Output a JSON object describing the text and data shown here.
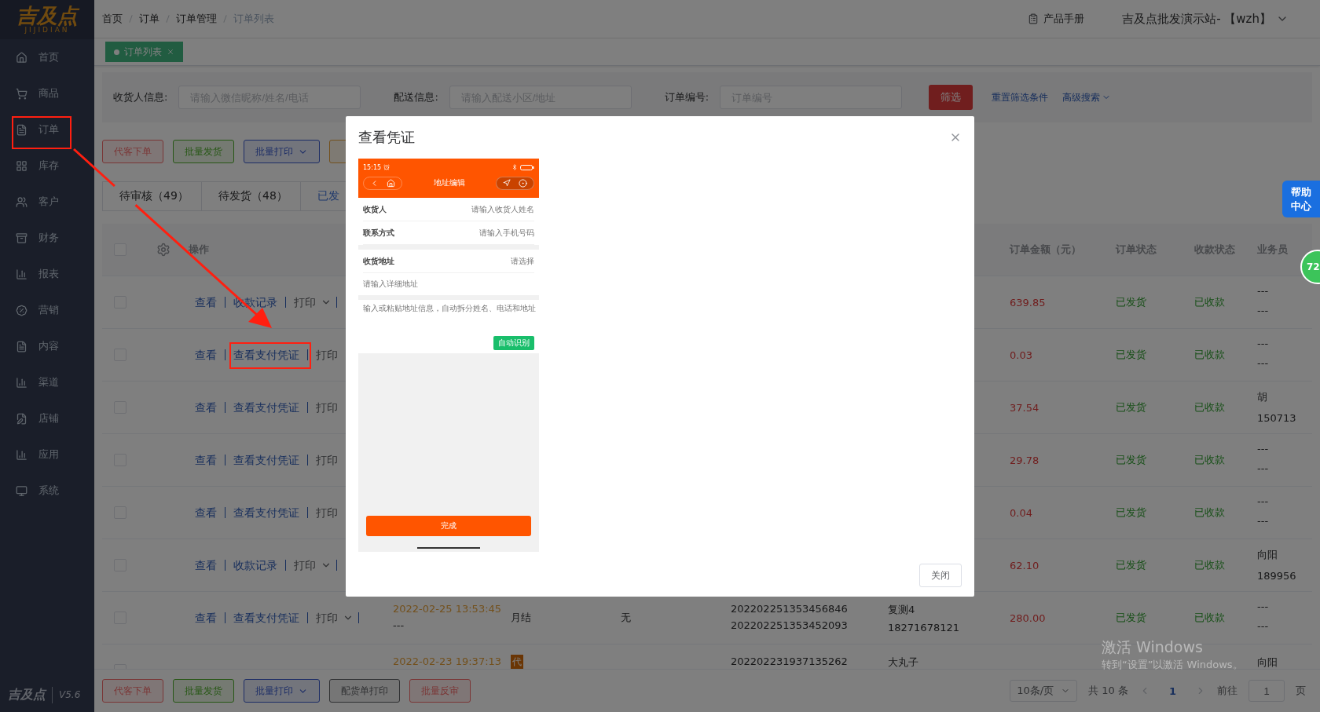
{
  "sidebar": {
    "logo": "吉及点",
    "logo_subtitle": "JIJIDIAN",
    "items": [
      {
        "label": "首页"
      },
      {
        "label": "商品"
      },
      {
        "label": "订单"
      },
      {
        "label": "库存"
      },
      {
        "label": "客户"
      },
      {
        "label": "财务"
      },
      {
        "label": "报表"
      },
      {
        "label": "营销"
      },
      {
        "label": "内容"
      },
      {
        "label": "渠道"
      },
      {
        "label": "店铺"
      },
      {
        "label": "应用"
      },
      {
        "label": "系统"
      }
    ],
    "footer_logo": "吉及点",
    "version": "V5.6"
  },
  "header": {
    "breadcrumb": [
      "首页",
      "订单",
      "订单管理",
      "订单列表"
    ],
    "manual": "产品手册",
    "user": "吉及点批发演示站- 【wzh】"
  },
  "tags": [
    {
      "label": "订单列表",
      "selected": true
    }
  ],
  "filters": [
    {
      "label": "收货人信息:",
      "placeholder": "请输入微信昵称/姓名/电话"
    },
    {
      "label": "配送信息:",
      "placeholder": "请输入配送小区/地址"
    },
    {
      "label": "订单编号:",
      "placeholder": "订单编号"
    }
  ],
  "filter_button": "筛选",
  "reset_link": "重置筛选条件",
  "advanced_link": "高级搜索",
  "actions": [
    {
      "label": "代客下单",
      "kind": "danger",
      "dropdown": false
    },
    {
      "label": "批量发货",
      "kind": "success",
      "dropdown": false
    },
    {
      "label": "批量打印",
      "kind": "primary",
      "dropdown": true
    },
    {
      "kind": "warning",
      "dropdown": false
    }
  ],
  "status_tabs": [
    {
      "label": "待审核（49）",
      "selected": false
    },
    {
      "label": "待发货（48）",
      "selected": false
    },
    {
      "label": "已发",
      "selected": true
    }
  ],
  "table": {
    "select_all_checked": false,
    "ops_column": "操作",
    "columns": [
      "订单金额（元）",
      "订单状态",
      "收款状态",
      "业务员"
    ],
    "rows": [
      {
        "checked": false,
        "ops": [
          "查看",
          "收款记录",
          "打印"
        ],
        "caret": true,
        "amount": "639.85",
        "order_status": "已发货",
        "pay_status": "已收款",
        "salesman": [
          "---",
          "---"
        ]
      },
      {
        "checked": false,
        "ops": [
          "查看",
          "查看支付凭证",
          "打印"
        ],
        "caret": false,
        "amount": "0.03",
        "order_status": "已发货",
        "pay_status": "已收款",
        "salesman": [
          "---",
          "---"
        ]
      },
      {
        "checked": false,
        "ops": [
          "查看",
          "查看支付凭证",
          "打印"
        ],
        "caret": false,
        "amount": "37.54",
        "order_status": "已发货",
        "pay_status": "已收款",
        "salesman": [
          "胡",
          "150713"
        ]
      },
      {
        "checked": false,
        "ops": [
          "查看",
          "查看支付凭证",
          "打印"
        ],
        "caret": false,
        "amount": "29.78",
        "order_status": "已发货",
        "pay_status": "已收款",
        "salesman": [
          "---",
          "---"
        ]
      },
      {
        "checked": false,
        "ops": [
          "查看",
          "查看支付凭证",
          "打印"
        ],
        "caret": false,
        "amount": "0.04",
        "order_status": "已发货",
        "pay_status": "已收款",
        "salesman": [
          "---",
          "---"
        ]
      },
      {
        "checked": false,
        "ops": [
          "查看",
          "收款记录",
          "打印"
        ],
        "caret": true,
        "amount": "62.10",
        "order_status": "已发货",
        "pay_status": "已收款",
        "salesman": [
          "向阳",
          "189956"
        ]
      },
      {
        "checked": false,
        "ops": [
          "查看",
          "查看支付凭证",
          "打印"
        ],
        "caret": true,
        "date": [
          "2022-02-25 13:53:45",
          "---"
        ],
        "settle": "月结",
        "column_3": "无",
        "order_numbers": [
          "202202251353456846",
          "202202251353452093"
        ],
        "customer": [
          "复测4",
          "18271678121"
        ],
        "amount": "280.00",
        "order_status": "已发货",
        "pay_status": "已收款",
        "salesman": [
          "---",
          "---"
        ]
      },
      {
        "checked": false,
        "ops": [],
        "date": [
          "2022-02-23 19:37:13"
        ],
        "settle_tag": "代",
        "order_numbers": [
          "202202231937135262"
        ],
        "customer": [
          "大丸子"
        ],
        "salesman": [
          "向阳"
        ]
      }
    ]
  },
  "footer": {
    "actions": [
      {
        "label": "代客下单",
        "kind": "danger",
        "dropdown": false
      },
      {
        "label": "批量发货",
        "kind": "success",
        "dropdown": false
      },
      {
        "label": "批量打印",
        "kind": "primary",
        "dropdown": true
      },
      {
        "label": "配货单打印",
        "kind": "default",
        "dropdown": false
      },
      {
        "label": "批量反审",
        "kind": "danger",
        "dropdown": false
      }
    ],
    "page_size": "10条/页",
    "total": "共 10 条",
    "pages": [
      {
        "label": "1",
        "selected": true
      }
    ],
    "goto": "前往",
    "page_input": "1",
    "page_unit": "页"
  },
  "help": "帮助中心",
  "badge": "72",
  "modal": {
    "title": "查看凭证",
    "close_button": "关闭",
    "screenshot": {
      "time": "15:15",
      "title": "地址编辑",
      "groups": [
        [
          {
            "label": "收货人",
            "placeholder": "请输入收货人姓名"
          },
          {
            "label": "联系方式",
            "placeholder": "请输入手机号码"
          }
        ],
        [
          {
            "label": "收货地址",
            "placeholder": "请选择"
          }
        ]
      ],
      "detail_placeholder": "请输入详细地址",
      "paste_hint": "输入或粘贴地址信息，自动拆分姓名、电话和地址",
      "recognize_button": "自动识别",
      "done_button": "完成"
    }
  },
  "watermark": [
    "激活 Windows",
    "转到“设置”以激活 Windows。"
  ]
}
